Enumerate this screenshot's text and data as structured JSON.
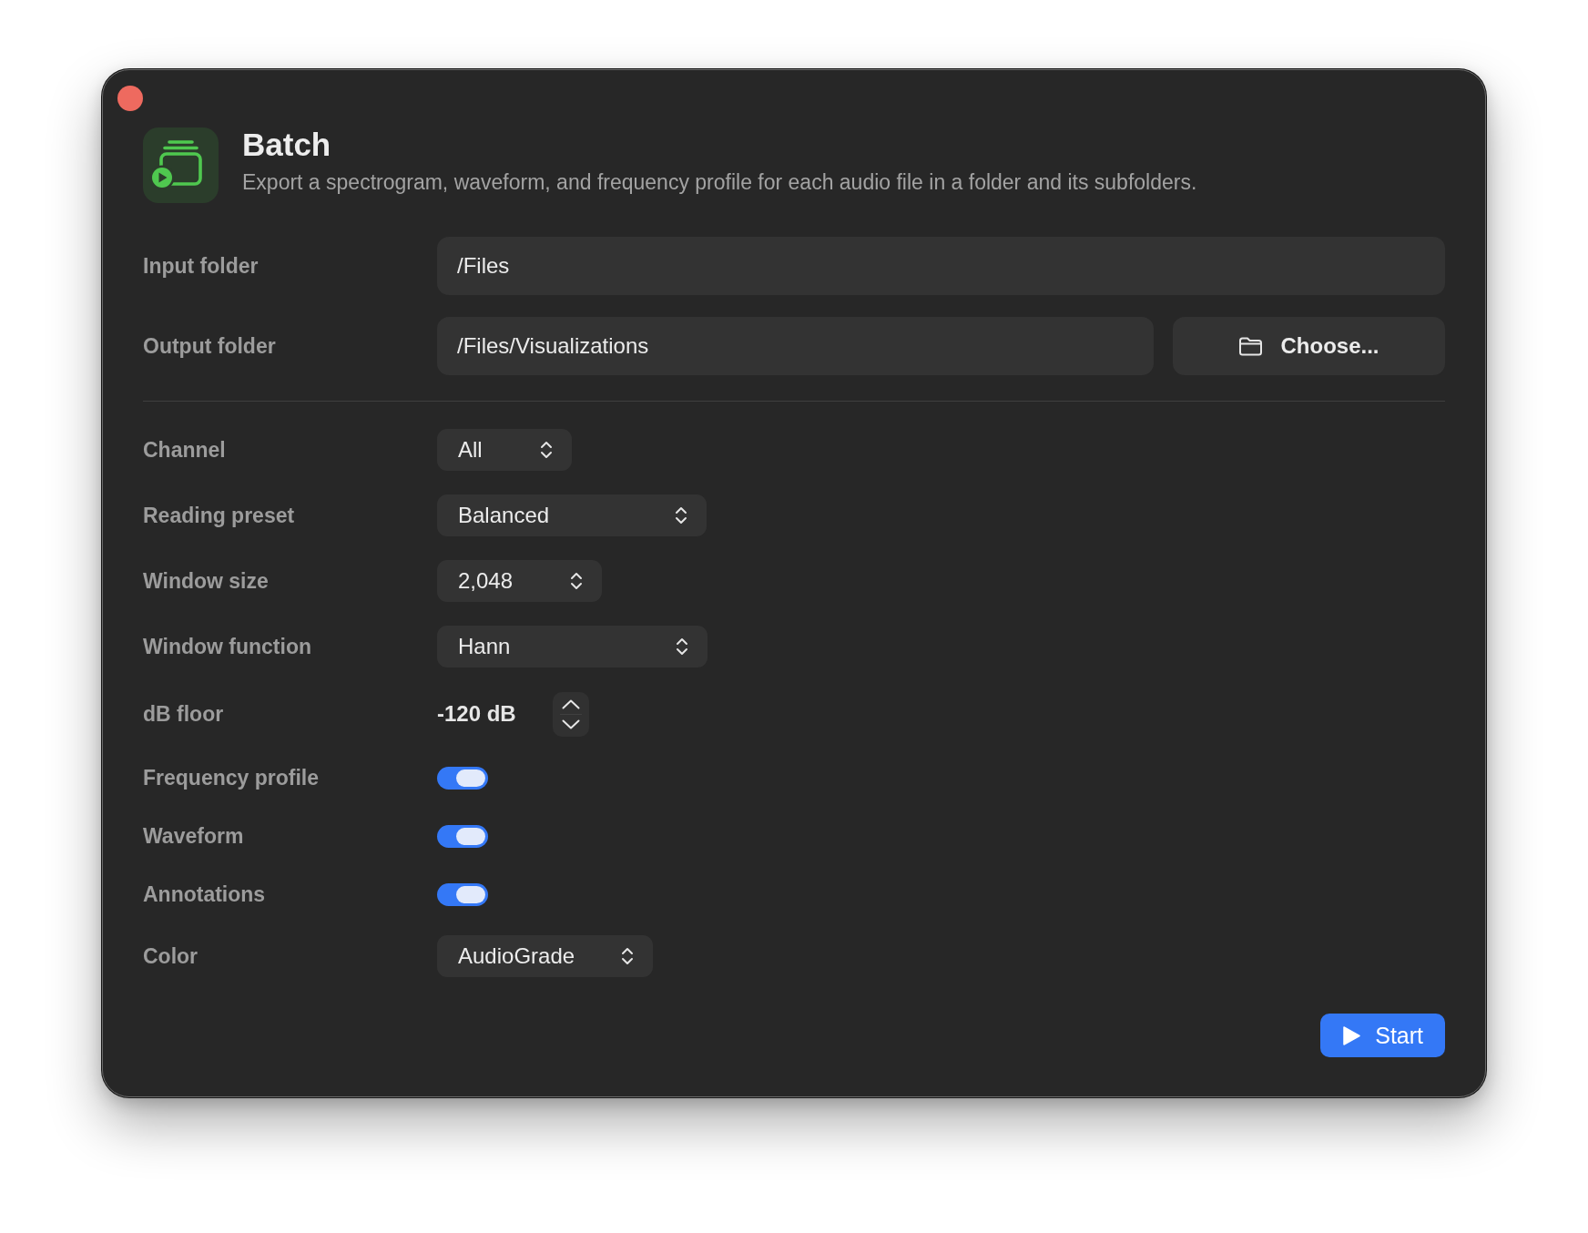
{
  "header": {
    "title": "Batch",
    "description": "Export a spectrogram, waveform, and frequency profile for each audio file in a folder and its subfolders."
  },
  "paths": [
    {
      "label": "Input folder",
      "value": "/Files"
    },
    {
      "label": "Output folder",
      "value": "/Files/Visualizations",
      "button": "Choose..."
    }
  ],
  "settings": [
    {
      "kind": "select",
      "label": "Channel",
      "value": "All"
    },
    {
      "kind": "select",
      "label": "Reading preset",
      "value": "Balanced"
    },
    {
      "kind": "select",
      "label": "Window size",
      "value": "2,048"
    },
    {
      "kind": "select",
      "label": "Window function",
      "value": "Hann"
    },
    {
      "kind": "stepper",
      "label": "dB floor",
      "value": "-120 dB"
    },
    {
      "kind": "toggle",
      "label": "Frequency profile",
      "on": true
    },
    {
      "kind": "toggle",
      "label": "Waveform",
      "on": true
    },
    {
      "kind": "toggle",
      "label": "Annotations",
      "on": true
    },
    {
      "kind": "select",
      "label": "Color",
      "value": "AudioGrade"
    }
  ],
  "start_button": "Start"
}
